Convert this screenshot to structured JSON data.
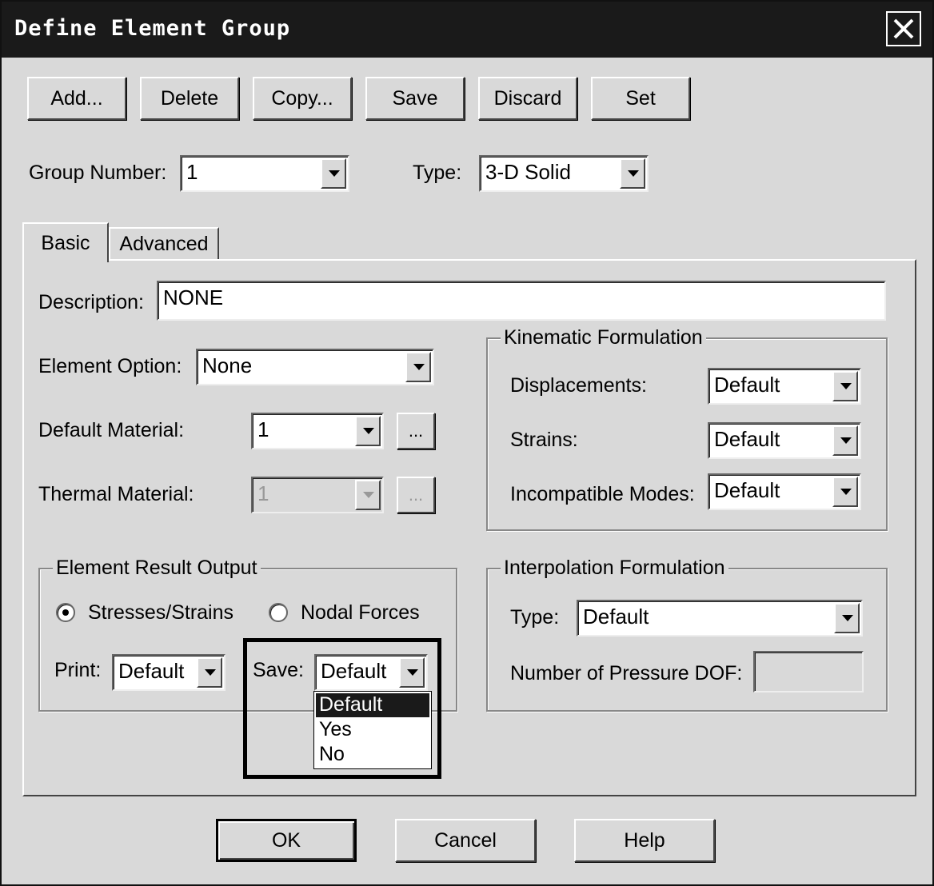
{
  "window": {
    "title": "Define Element Group"
  },
  "toolbar": {
    "add": "Add...",
    "delete": "Delete",
    "copy": "Copy...",
    "save": "Save",
    "discard": "Discard",
    "set": "Set"
  },
  "group_number": {
    "label": "Group Number:",
    "value": "1"
  },
  "type": {
    "label": "Type:",
    "value": "3-D Solid"
  },
  "tabs": {
    "basic": "Basic",
    "advanced": "Advanced"
  },
  "basic": {
    "description": {
      "label": "Description:",
      "value": "NONE"
    },
    "element_option": {
      "label": "Element Option:",
      "value": "None"
    },
    "default_material": {
      "label": "Default Material:",
      "value": "1",
      "browse": "..."
    },
    "thermal_material": {
      "label": "Thermal Material:",
      "value": "1",
      "browse": "..."
    },
    "kinematic": {
      "legend": "Kinematic Formulation",
      "displacements": {
        "label": "Displacements:",
        "value": "Default"
      },
      "strains": {
        "label": "Strains:",
        "value": "Default"
      },
      "incompatible": {
        "label": "Incompatible Modes:",
        "value": "Default"
      }
    },
    "result_output": {
      "legend": "Element Result Output",
      "stresses": "Stresses/Strains",
      "nodal": "Nodal Forces",
      "print": {
        "label": "Print:",
        "value": "Default"
      },
      "save": {
        "label": "Save:",
        "value": "Default",
        "options": [
          "Default",
          "Yes",
          "No"
        ]
      }
    },
    "interpolation": {
      "legend": "Interpolation Formulation",
      "type": {
        "label": "Type:",
        "value": "Default"
      },
      "pressure_dof": {
        "label": "Number of Pressure DOF:",
        "value": ""
      }
    }
  },
  "footer": {
    "ok": "OK",
    "cancel": "Cancel",
    "help": "Help"
  }
}
